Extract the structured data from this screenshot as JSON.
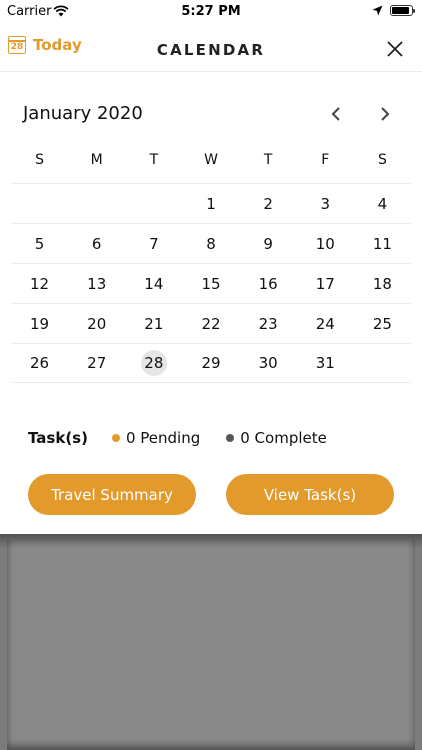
{
  "status_bar": {
    "carrier": "Carrier",
    "time": "5:27 PM",
    "battery_level": 0.9
  },
  "nav": {
    "today_label": "Today",
    "today_icon_number": "28",
    "title": "CALENDAR"
  },
  "calendar": {
    "month_label": "January 2020",
    "weekdays": [
      "S",
      "M",
      "T",
      "W",
      "T",
      "F",
      "S"
    ],
    "weeks": [
      [
        "",
        "",
        "",
        "1",
        "2",
        "3",
        "4"
      ],
      [
        "5",
        "6",
        "7",
        "8",
        "9",
        "10",
        "11"
      ],
      [
        "12",
        "13",
        "14",
        "15",
        "16",
        "17",
        "18"
      ],
      [
        "19",
        "20",
        "21",
        "22",
        "23",
        "24",
        "25"
      ],
      [
        "26",
        "27",
        "28",
        "29",
        "30",
        "31",
        ""
      ]
    ],
    "selected_day": "28"
  },
  "tasks": {
    "label": "Task(s)",
    "pending_text": "0 Pending",
    "complete_text": "0 Complete",
    "pending_color": "#e39a2d",
    "complete_color": "#555555"
  },
  "actions": {
    "travel_summary": "Travel Summary",
    "view_tasks": "View Task(s)"
  },
  "colors": {
    "accent": "#e39a2d"
  }
}
